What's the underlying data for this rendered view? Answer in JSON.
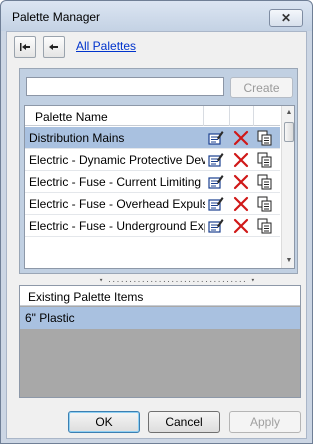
{
  "window": {
    "title": "Palette Manager",
    "close_glyph": "✕"
  },
  "nav": {
    "first_icon": "jump-first-icon",
    "back_icon": "back-arrow-icon",
    "all_palettes_link": "All Palettes"
  },
  "search": {
    "value": "",
    "placeholder": "",
    "create_label": "Create",
    "create_enabled": false
  },
  "palette_table": {
    "column_header": "Palette Name",
    "row_icons": [
      "edit-icon",
      "delete-icon",
      "copy-icon"
    ],
    "rows": [
      {
        "name": "Distribution Mains",
        "selected": true
      },
      {
        "name": "Electric - Dynamic Protective Devi...",
        "selected": false
      },
      {
        "name": "Electric - Fuse - Current Limiting",
        "selected": false
      },
      {
        "name": "Electric - Fuse - Overhead Expulsion",
        "selected": false
      },
      {
        "name": "Electric - Fuse - Underground Exp...",
        "selected": false
      }
    ]
  },
  "items_panel": {
    "column_header": "Existing Palette Items",
    "rows": [
      {
        "name": "6\" Plastic",
        "selected": true
      }
    ]
  },
  "footer": {
    "ok_label": "OK",
    "cancel_label": "Cancel",
    "apply_label": "Apply",
    "apply_enabled": false
  },
  "colors": {
    "selection": "#a9c1e0",
    "link": "#0033cc",
    "delete_red": "#d01818",
    "edit_blue": "#1a3f8f"
  }
}
